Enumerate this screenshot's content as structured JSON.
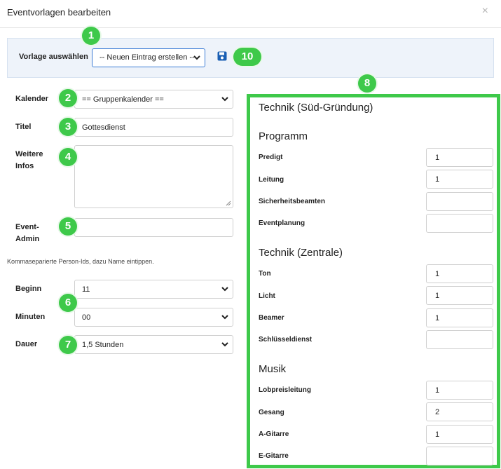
{
  "header": {
    "title": "Eventvorlagen bearbeiten",
    "close": "×"
  },
  "template": {
    "label": "Vorlage auswählen",
    "value": "-- Neuen Eintrag erstellen --"
  },
  "form": {
    "calendar": {
      "label": "Kalender",
      "value": "== Gruppenkalender =="
    },
    "title": {
      "label": "Titel",
      "value": "Gottesdienst"
    },
    "info": {
      "label_line1": "Weitere",
      "label_line2": "Infos",
      "value": ""
    },
    "admin": {
      "label_line1": "Event-",
      "label_line2": "Admin",
      "value": ""
    },
    "hint": "Kommaseparierte Person-Ids, dazu Name eintippen.",
    "begin": {
      "label": "Beginn",
      "value": "11"
    },
    "minutes": {
      "label": "Minuten",
      "value": "00"
    },
    "duration": {
      "label": "Dauer",
      "value": "1,5 Stunden"
    }
  },
  "badges": [
    "1",
    "2",
    "3",
    "4",
    "5",
    "6",
    "7",
    "8",
    "10"
  ],
  "panel": {
    "title": "Technik (Süd-Gründung)",
    "groups": [
      {
        "title": "Programm",
        "rows": [
          {
            "label": "Predigt",
            "value": "1"
          },
          {
            "label": "Leitung",
            "value": "1"
          },
          {
            "label": "Sicherheitsbeamten",
            "value": ""
          },
          {
            "label": "Eventplanung",
            "value": ""
          }
        ]
      },
      {
        "title": "Technik (Zentrale)",
        "rows": [
          {
            "label": "Ton",
            "value": "1"
          },
          {
            "label": "Licht",
            "value": "1"
          },
          {
            "label": "Beamer",
            "value": "1"
          },
          {
            "label": "Schlüsseldienst",
            "value": ""
          }
        ]
      },
      {
        "title": "Musik",
        "rows": [
          {
            "label": "Lobpreisleitung",
            "value": "1"
          },
          {
            "label": "Gesang",
            "value": "2"
          },
          {
            "label": "A-Gitarre",
            "value": "1"
          },
          {
            "label": "E-Gitarre",
            "value": ""
          }
        ]
      }
    ]
  },
  "colors": {
    "highlight": "#3ec94a",
    "select_border": "#3a7bd5",
    "save_icon": "#1a5fb4"
  },
  "icons": {
    "save": "floppy-disk-icon",
    "dropdown": "chevron-down-icon",
    "close": "close-icon"
  }
}
